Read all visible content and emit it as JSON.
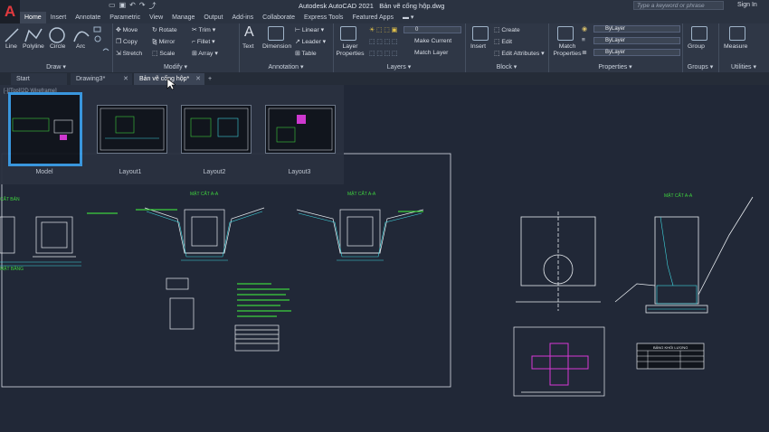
{
  "app": {
    "logo": "A",
    "title": "Autodesk AutoCAD 2021",
    "filename": "Bản vẽ cống hộp.dwg",
    "search_placeholder": "Type a keyword or phrase",
    "signin": "Sign In"
  },
  "menu": [
    "Home",
    "Insert",
    "Annotate",
    "Parametric",
    "View",
    "Manage",
    "Output",
    "Add-ins",
    "Collaborate",
    "Express Tools",
    "Featured Apps"
  ],
  "ribbon": {
    "draw": {
      "label": "Draw",
      "line": "Line",
      "polyline": "Polyline",
      "circle": "Circle",
      "arc": "Arc"
    },
    "modify": {
      "label": "Modify",
      "move": "Move",
      "rotate": "Rotate",
      "trim": "Trim",
      "copy": "Copy",
      "mirror": "Mirror",
      "fillet": "Fillet",
      "stretch": "Stretch",
      "scale": "Scale",
      "array": "Array"
    },
    "annotation": {
      "label": "Annotation",
      "text": "Text",
      "dimension": "Dimension",
      "linear": "Linear",
      "leader": "Leader",
      "table": "Table"
    },
    "layers": {
      "label": "Layers",
      "layer_properties": "Layer Properties",
      "layer_value": "0",
      "make_current": "Make Current",
      "match_layer": "Match Layer"
    },
    "block": {
      "label": "Block",
      "insert": "Insert",
      "create": "Create",
      "edit": "Edit",
      "edit_attributes": "Edit Attributes"
    },
    "properties": {
      "label": "Properties",
      "match_properties": "Match Properties",
      "bylayer1": "ByLayer",
      "bylayer2": "ByLayer",
      "bylayer3": "ByLayer"
    },
    "groups": {
      "label": "Groups",
      "group": "Group"
    },
    "utilities": {
      "label": "Utilities",
      "measure": "Measure"
    }
  },
  "tabs": [
    {
      "label": "Start",
      "closable": false
    },
    {
      "label": "Drawing3*",
      "closable": true
    },
    {
      "label": "Bản vẽ cống hộp*",
      "closable": true
    }
  ],
  "layouts": [
    "Model",
    "Layout1",
    "Layout2",
    "Layout3"
  ],
  "drawing": {
    "label_a1": "MẶT CẮT A-A",
    "label_a2": "MẶT CẮT A-A",
    "label_a3": "MẶT CẮT A-A",
    "label_left": "CẮT BẢN",
    "label_left2": "MẶT BẰNG",
    "table_title": "BẢNG KHỐI LƯỢNG",
    "top_left_view": "[-][Top][2D Wireframe]"
  },
  "colors": {
    "accent": "#3b9be4",
    "green": "#3ed13e",
    "cyan": "#3fd6df",
    "magenta": "#d639d6",
    "white": "#e8ecf0"
  }
}
